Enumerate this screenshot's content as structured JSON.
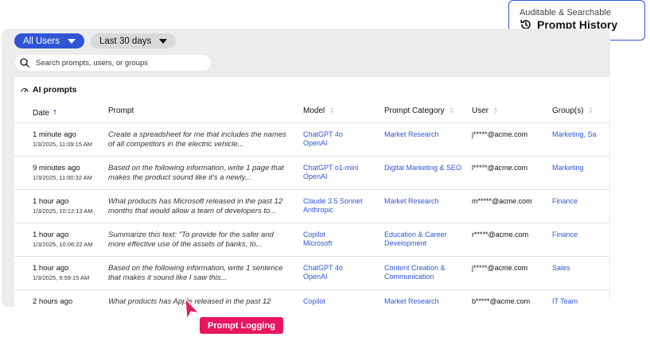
{
  "callout": {
    "subtitle": "Auditable & Searchable",
    "title": "Prompt History",
    "icon": "history-icon"
  },
  "filters": {
    "users": "All Users",
    "range": "Last 30 days"
  },
  "search": {
    "placeholder": "Search prompts, users, or groups"
  },
  "section": {
    "title": "AI prompts",
    "icon": "ai-prompts-icon"
  },
  "columns": {
    "date": "Date",
    "prompt": "Prompt",
    "model": "Model",
    "category": "Prompt Category",
    "user": "User",
    "group": "Group(s)"
  },
  "rows": [
    {
      "rel": "1 minute ago",
      "abs": "1/3/2025, 11:09:15 AM",
      "prompt": "Create a spreadsheet for me that includes the names of all competitors in the electric vehicle...",
      "model": "ChatGPT 4o",
      "provider": "OpenAI",
      "category": "Market Research",
      "user": "j*****@acme.com",
      "group": "Marketing, Sa"
    },
    {
      "rel": "9 minutes ago",
      "abs": "1/3/2025, 11:00:32 AM",
      "prompt": "Based on the following information, write 1 page that makes the product sound like it's a newly...",
      "model": "ChatGPT o1-mini",
      "provider": "OpenAI",
      "category": "Digital Marketing & SEO",
      "user": "l*****@acme.com",
      "group": "Marketing"
    },
    {
      "rel": "1 hour ago",
      "abs": "1/3/2025, 10:12:13 AM",
      "prompt": "What products has Microsoft released in the past 12 months that would allow a team of developers to...",
      "model": "Claude 3.5 Sonnet",
      "provider": "Anthropic",
      "category": "Market Research",
      "user": "m*****@acme.com",
      "group": "Finance"
    },
    {
      "rel": "1 hour ago",
      "abs": "1/3/2025, 10:06:22 AM",
      "prompt": "Summarize this text: \"To provide for the safer and more effective use of the assets of banks, to...",
      "model": "Copilot",
      "provider": "Microsoft",
      "category": "Education & Career Development",
      "user": "r*****@acme.com",
      "group": "Finance"
    },
    {
      "rel": "1 hour ago",
      "abs": "1/3/2025, 9:59:15 AM",
      "prompt": "Based on the following information, write 1 sentence that makes it sound like I saw this...",
      "model": "ChatGPT 4o",
      "provider": "OpenAI",
      "category": "Content Creation & Communication",
      "user": "j*****@acme.com",
      "group": "Sales"
    },
    {
      "rel": "2 hours ago",
      "abs": "",
      "prompt": "What products has Apple released in the past 12",
      "model": "Copilot",
      "provider": "",
      "category": "Market Research",
      "user": "b*****@acme.com",
      "group": "IT Team"
    }
  ],
  "badge": {
    "label": "Prompt Logging"
  },
  "colors": {
    "accent": "#2f55d4",
    "badge": "#e8155f",
    "panel": "#ececec"
  }
}
